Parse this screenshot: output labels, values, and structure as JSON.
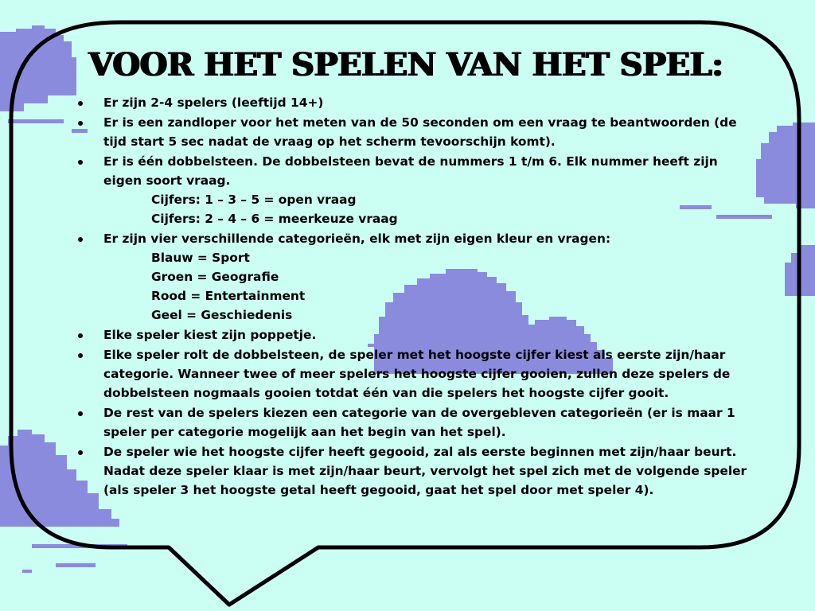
{
  "colors": {
    "background": "#ccfff4",
    "cloud": "#8b8bde",
    "bubble_outline": "#000000",
    "text": "#000000"
  },
  "title": "VOOR HET SPELEN VAN HET SPEL:",
  "rules": [
    {
      "text": "Er zijn 2-4 spelers (leeftijd 14+)",
      "sub": []
    },
    {
      "text": "Er is een zandloper voor het meten van de 50 seconden om een vraag te beantwoorden (de tijd start 5 sec nadat de vraag op het scherm tevoorschijn komt).",
      "sub": []
    },
    {
      "text": "Er is één dobbelsteen. De dobbelsteen bevat de nummers 1 t/m 6. Elk nummer heeft zijn eigen soort vraag.",
      "sub": [
        "Cijfers: 1 – 3 – 5 = open vraag",
        "Cijfers: 2 – 4 – 6 = meerkeuze vraag"
      ]
    },
    {
      "text": "Er zijn vier verschillende categorieën, elk met zijn eigen kleur en vragen:",
      "sub": [
        "Blauw = Sport",
        "Groen = Geografie",
        "Rood = Entertainment",
        "Geel = Geschiedenis"
      ]
    },
    {
      "text": "Elke speler kiest zijn poppetje.",
      "sub": []
    },
    {
      "text": "Elke speler rolt de dobbelsteen, de speler met het hoogste cijfer kiest als eerste zijn/haar categorie.  Wanneer twee of meer spelers het hoogste cijfer gooien, zullen deze spelers de dobbelsteen nogmaals gooien totdat één van die spelers het hoogste cijfer gooit.",
      "sub": []
    },
    {
      "text": "De rest van de spelers kiezen een categorie van de overgebleven categorieën (er is maar 1 speler per categorie mogelijk aan het begin van het spel).",
      "sub": []
    },
    {
      "text": "De speler wie het hoogste cijfer heeft gegooid, zal als eerste beginnen met zijn/haar beurt. Nadat deze speler klaar is met zijn/haar beurt, vervolgt het spel zich met de volgende speler (als speler 3 het hoogste getal heeft gegooid, gaat het spel door met speler 4).",
      "sub": []
    }
  ]
}
